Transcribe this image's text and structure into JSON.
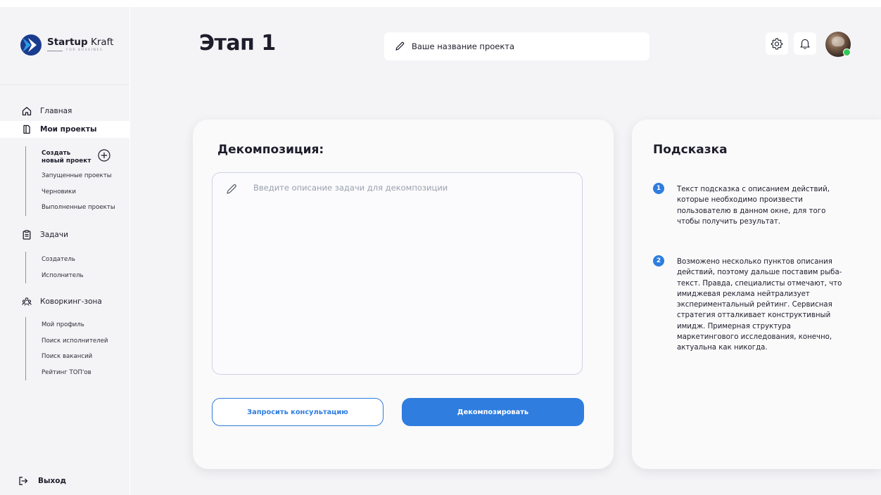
{
  "brand": {
    "name_bold": "Startup",
    "name_regular": " Kraft",
    "tagline": "FOR BUSSINES"
  },
  "sidebar": {
    "items": [
      {
        "label": "Главная",
        "icon": "home-icon"
      },
      {
        "label": "Мои проекты",
        "icon": "folder-icon",
        "active": true
      },
      {
        "label": "Задачи",
        "icon": "clipboard-icon"
      },
      {
        "label": "Коворкинг-зона",
        "icon": "people-icon"
      }
    ],
    "projects_sub": {
      "create_line1": "Создать",
      "create_line2": "новый проект",
      "items": [
        "Запущенные проекты",
        "Черновики",
        "Выполненные проекты"
      ]
    },
    "tasks_sub": {
      "items": [
        "Создатель",
        "Исполнитель"
      ]
    },
    "cowork_sub": {
      "items": [
        "Мой профиль",
        "Поиск исполнителей",
        "Поиск вакансий",
        "Рейтинг ТОП'ов"
      ]
    },
    "logout_label": "Выход"
  },
  "header": {
    "title": "Этап 1",
    "project_name": "Ваше название проекта"
  },
  "decomposition": {
    "title": "Декомпозиция:",
    "placeholder": "Введите описание задачи для декомпозиции",
    "consult_label": "Запросить консультацию",
    "decompose_label": "Декомпозировать"
  },
  "hint": {
    "title": "Подсказка",
    "items": [
      {
        "num": "1",
        "text": "Текст подсказка с описанием действий, которые необходимо произвести пользователю в данном окне, для того чтобы получить результат."
      },
      {
        "num": "2",
        "text": "Возможено несколько пунктов описания действий, поэтому дальше поставим рыба-текст. Правда, специалисты отмечают, что имиджевая реклама нейтрализует экспериментальный рейтинг. Сервисная стратегия отталкивает конструктивный имидж. Примерная структура маркетингового исследования, конечно, актуальна как никогда."
      }
    ]
  },
  "colors": {
    "accent": "#2f7ddf",
    "online": "#34c759",
    "logo_dark": "#1a3c8f"
  }
}
